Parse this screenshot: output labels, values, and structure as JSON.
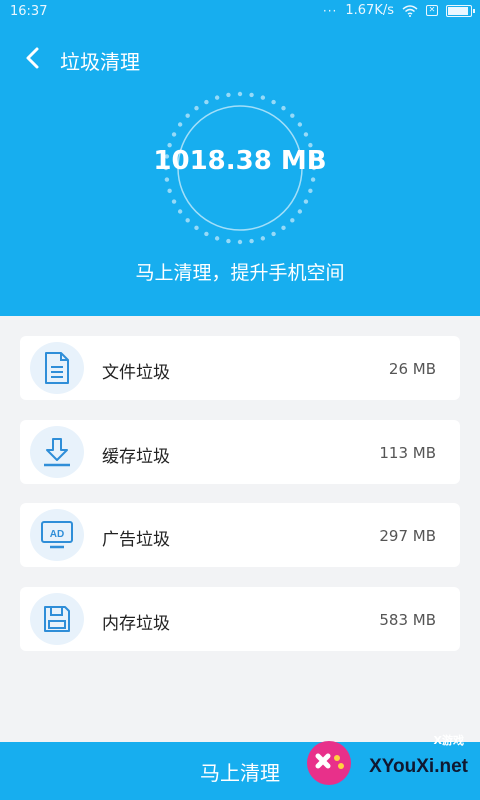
{
  "status_bar": {
    "time": "16:37",
    "network_speed": "1.67K/s",
    "icons": [
      "dots-icon",
      "wifi-icon",
      "x-box-icon",
      "battery-icon"
    ]
  },
  "header": {
    "back_icon": "chevron-left-icon",
    "title": "垃圾清理"
  },
  "summary": {
    "total_size": "1018.38 MB",
    "slogan": "马上清理，提升手机空间"
  },
  "items": [
    {
      "icon": "document-icon",
      "label": "文件垃圾",
      "size": "26 MB"
    },
    {
      "icon": "download-icon",
      "label": "缓存垃圾",
      "size": "113 MB"
    },
    {
      "icon": "ad-monitor-icon",
      "label": "广告垃圾",
      "size": "297 MB"
    },
    {
      "icon": "floppy-disk-icon",
      "label": "内存垃圾",
      "size": "583 MB"
    }
  ],
  "action": {
    "clean_label": "马上清理"
  },
  "watermark": {
    "text": "XYouXi.net",
    "sub": "X游戏"
  },
  "colors": {
    "primary": "#17aeef",
    "card_bg": "#ffffff",
    "page_bg": "#f2f3f5",
    "icon_bg": "#e8f2fb",
    "icon_stroke": "#2f8ed8"
  }
}
